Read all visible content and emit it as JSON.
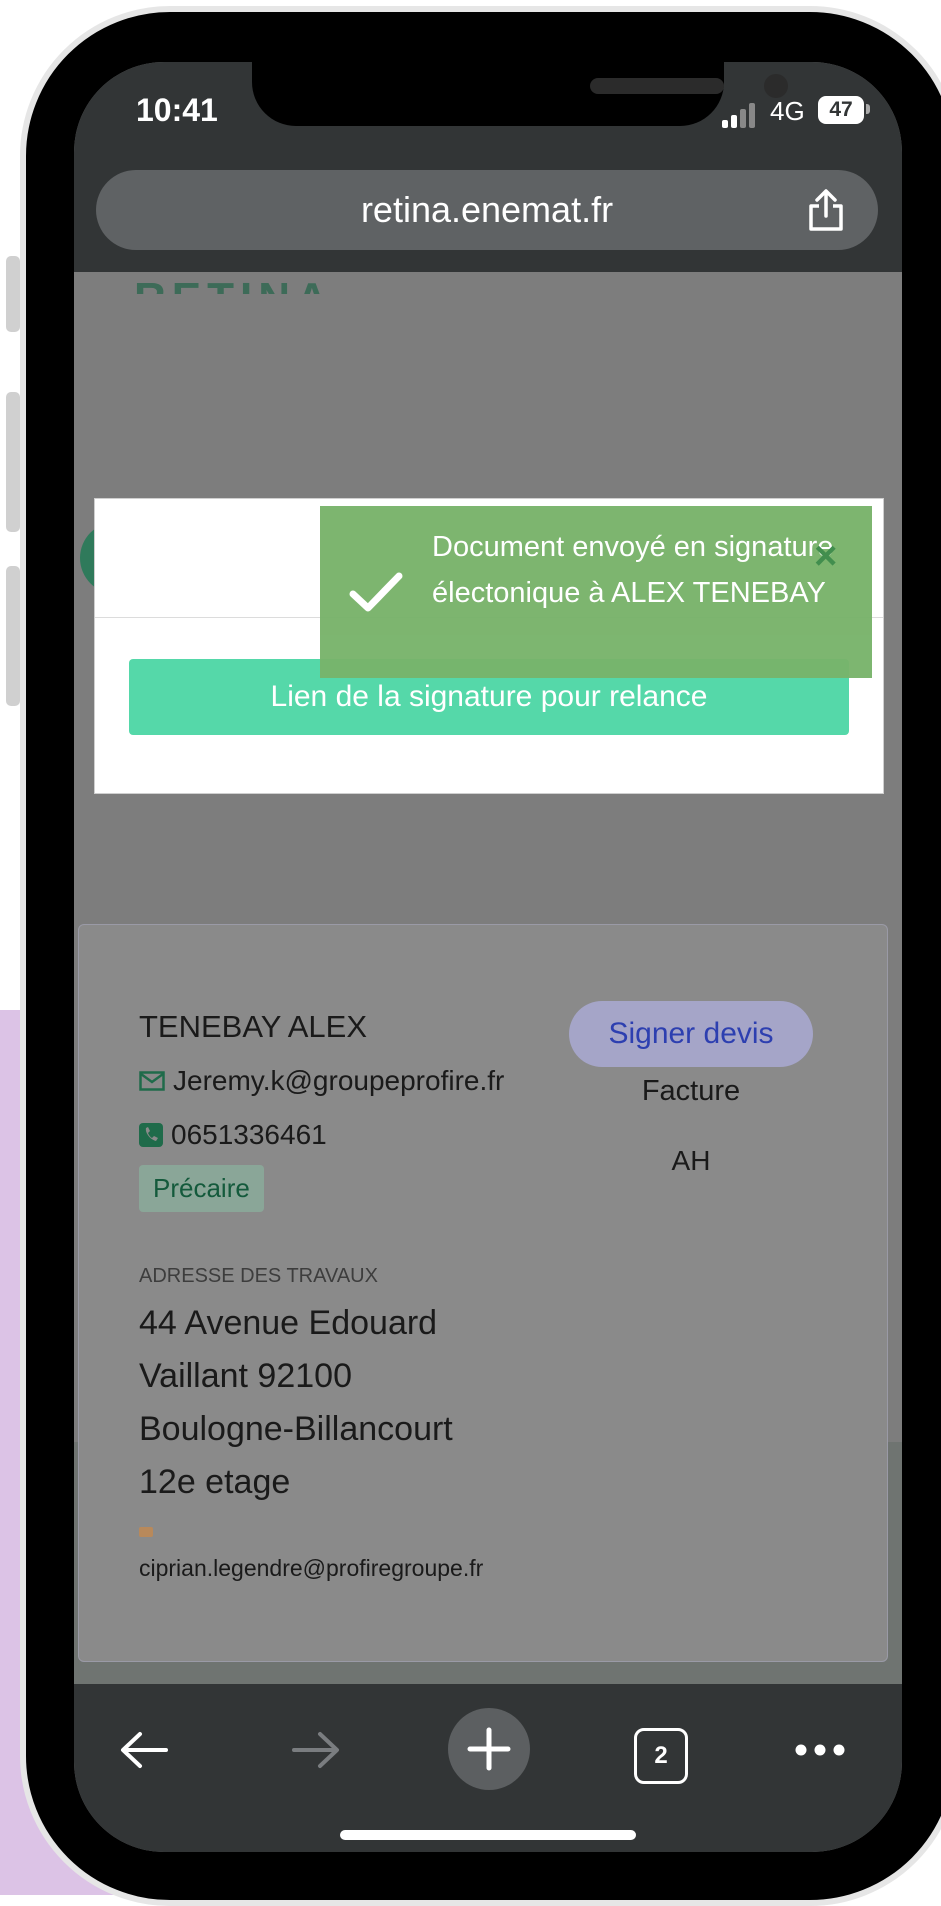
{
  "status_bar": {
    "time": "10:41",
    "network": "4G",
    "battery": "47"
  },
  "browser": {
    "url": "retina.enemat.fr",
    "open_tabs": "2"
  },
  "page": {
    "logo_peek": "RETINA"
  },
  "modal": {
    "relance_button_label": "Lien de la signature pour relance"
  },
  "toast": {
    "message": "Document envoyé en signature électonique à ALEX TENEBAY"
  },
  "client_card": {
    "name": "TENEBAY ALEX",
    "email": "Jeremy.k@groupeprofire.fr",
    "phone": "0651336461",
    "badge": "Précaire",
    "address_label": "ADRESSE DES TRAVAUX",
    "address": "44 Avenue Edouard Vaillant 92100 Boulogne-Billancourt 12e etage",
    "contact_email": "ciprian.legendre@profiregroupe.fr",
    "actions": {
      "sign": "Signer devis",
      "invoice": "Facture",
      "ah": "AH"
    }
  },
  "colors": {
    "toast_bg": "#78b36a",
    "relance_button": "#55d8a9",
    "sign_button_text": "#2d3fb0",
    "badge_text": "#145a3c",
    "browser_chrome": "#323536"
  },
  "icons": [
    "share-icon",
    "checkmark-icon",
    "close-icon",
    "envelope-icon",
    "phone-icon",
    "back-arrow-icon",
    "forward-arrow-icon",
    "plus-icon",
    "more-icon"
  ]
}
